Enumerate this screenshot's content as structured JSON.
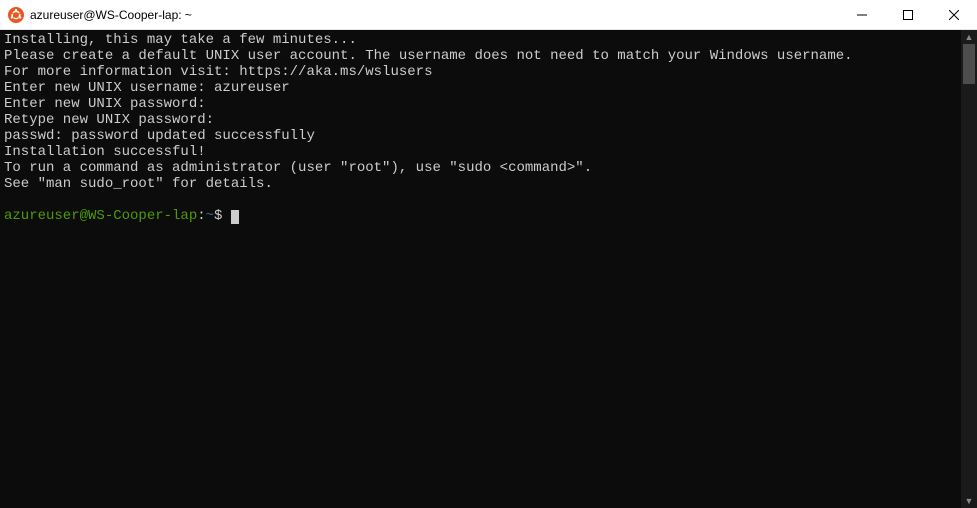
{
  "titlebar": {
    "title": "azureuser@WS-Cooper-lap: ~"
  },
  "terminal": {
    "lines": [
      "Installing, this may take a few minutes...",
      "Please create a default UNIX user account. The username does not need to match your Windows username.",
      "For more information visit: https://aka.ms/wslusers",
      "Enter new UNIX username: azureuser",
      "Enter new UNIX password:",
      "Retype new UNIX password:",
      "passwd: password updated successfully",
      "Installation successful!",
      "To run a command as administrator (user \"root\"), use \"sudo <command>\".",
      "See \"man sudo_root\" for details.",
      ""
    ],
    "prompt": {
      "userhost": "azureuser@WS-Cooper-lap",
      "colon": ":",
      "path": "~",
      "symbol": "$"
    }
  }
}
